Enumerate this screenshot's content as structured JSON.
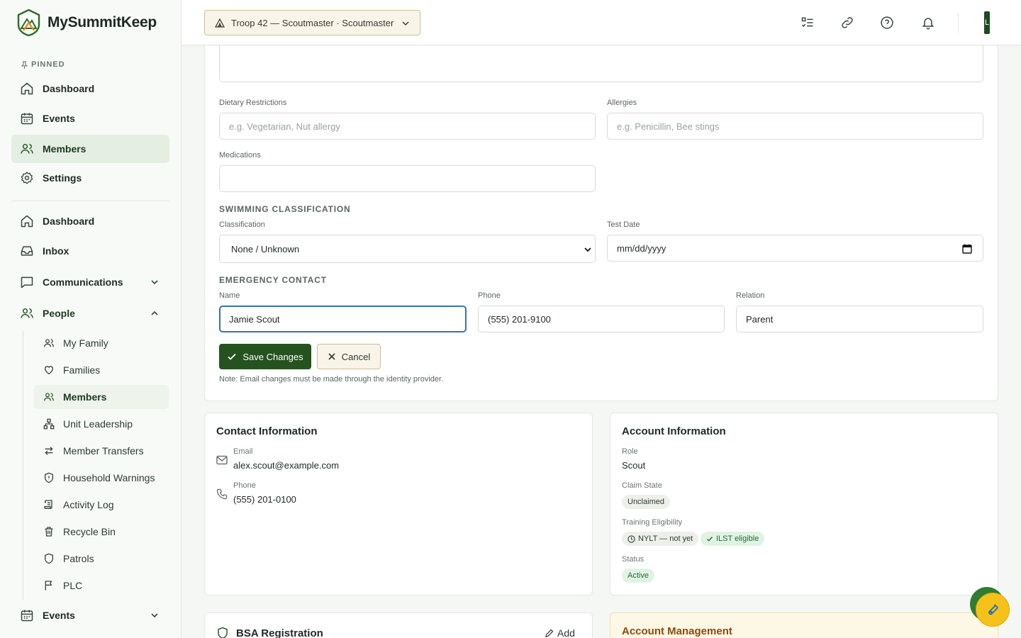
{
  "app": {
    "name": "MySummitKeep"
  },
  "sidebar": {
    "pinned_label": "PINNED",
    "pinned": [
      {
        "label": "Dashboard"
      },
      {
        "label": "Events"
      },
      {
        "label": "Members"
      },
      {
        "label": "Settings"
      }
    ],
    "main": [
      {
        "label": "Dashboard"
      },
      {
        "label": "Inbox"
      },
      {
        "label": "Communications"
      },
      {
        "label": "People"
      }
    ],
    "people_sub": [
      {
        "label": "My Family"
      },
      {
        "label": "Families"
      },
      {
        "label": "Members"
      },
      {
        "label": "Unit Leadership"
      },
      {
        "label": "Member Transfers"
      },
      {
        "label": "Household Warnings"
      },
      {
        "label": "Activity Log"
      },
      {
        "label": "Recycle Bin"
      },
      {
        "label": "Patrols"
      },
      {
        "label": "PLC"
      }
    ],
    "events_label": "Events"
  },
  "topbar": {
    "troop_selector": "Troop 42 — Scoutmaster · Scoutmaster",
    "avatar_initial": "L",
    "icons": [
      "checklist-icon",
      "link-icon",
      "help-icon",
      "bell-icon"
    ]
  },
  "form": {
    "dietary": {
      "label": "Dietary Restrictions",
      "placeholder": "e.g. Vegetarian, Nut allergy",
      "value": ""
    },
    "allergies": {
      "label": "Allergies",
      "placeholder": "e.g. Penicillin, Bee stings",
      "value": ""
    },
    "medications": {
      "label": "Medications",
      "value": ""
    },
    "swimming": {
      "title": "SWIMMING CLASSIFICATION",
      "classification_label": "Classification",
      "classification_value": "None / Unknown",
      "test_date_label": "Test Date",
      "test_date_placeholder": "mm/dd/yyyy"
    },
    "emergency": {
      "title": "EMERGENCY CONTACT",
      "name_label": "Name",
      "name_value": "Jamie Scout",
      "phone_label": "Phone",
      "phone_value": "(555) 201-9100",
      "relation_label": "Relation",
      "relation_value": "Parent"
    },
    "save_label": "Save Changes",
    "cancel_label": "Cancel",
    "note": "Note: Email changes must be made through the identity provider."
  },
  "contact": {
    "title": "Contact Information",
    "email_label": "Email",
    "email_value": "alex.scout@example.com",
    "phone_label": "Phone",
    "phone_value": "(555) 201-0100"
  },
  "account": {
    "title": "Account Information",
    "role_label": "Role",
    "role_value": "Scout",
    "claim_label": "Claim State",
    "claim_value": "Unclaimed",
    "training_label": "Training Eligibility",
    "nylt_badge": "NYLT — not yet",
    "ilst_badge": "ILST eligible",
    "status_label": "Status",
    "status_value": "Active"
  },
  "bsa": {
    "title": "BSA Registration",
    "add_label": "Add"
  },
  "account_mgmt": {
    "title": "Account Management"
  },
  "colors": {
    "accent": "#25521f",
    "focus": "#3b6fb5",
    "fab_yellow": "#f6c21a",
    "fab_green": "#2e7d32"
  }
}
